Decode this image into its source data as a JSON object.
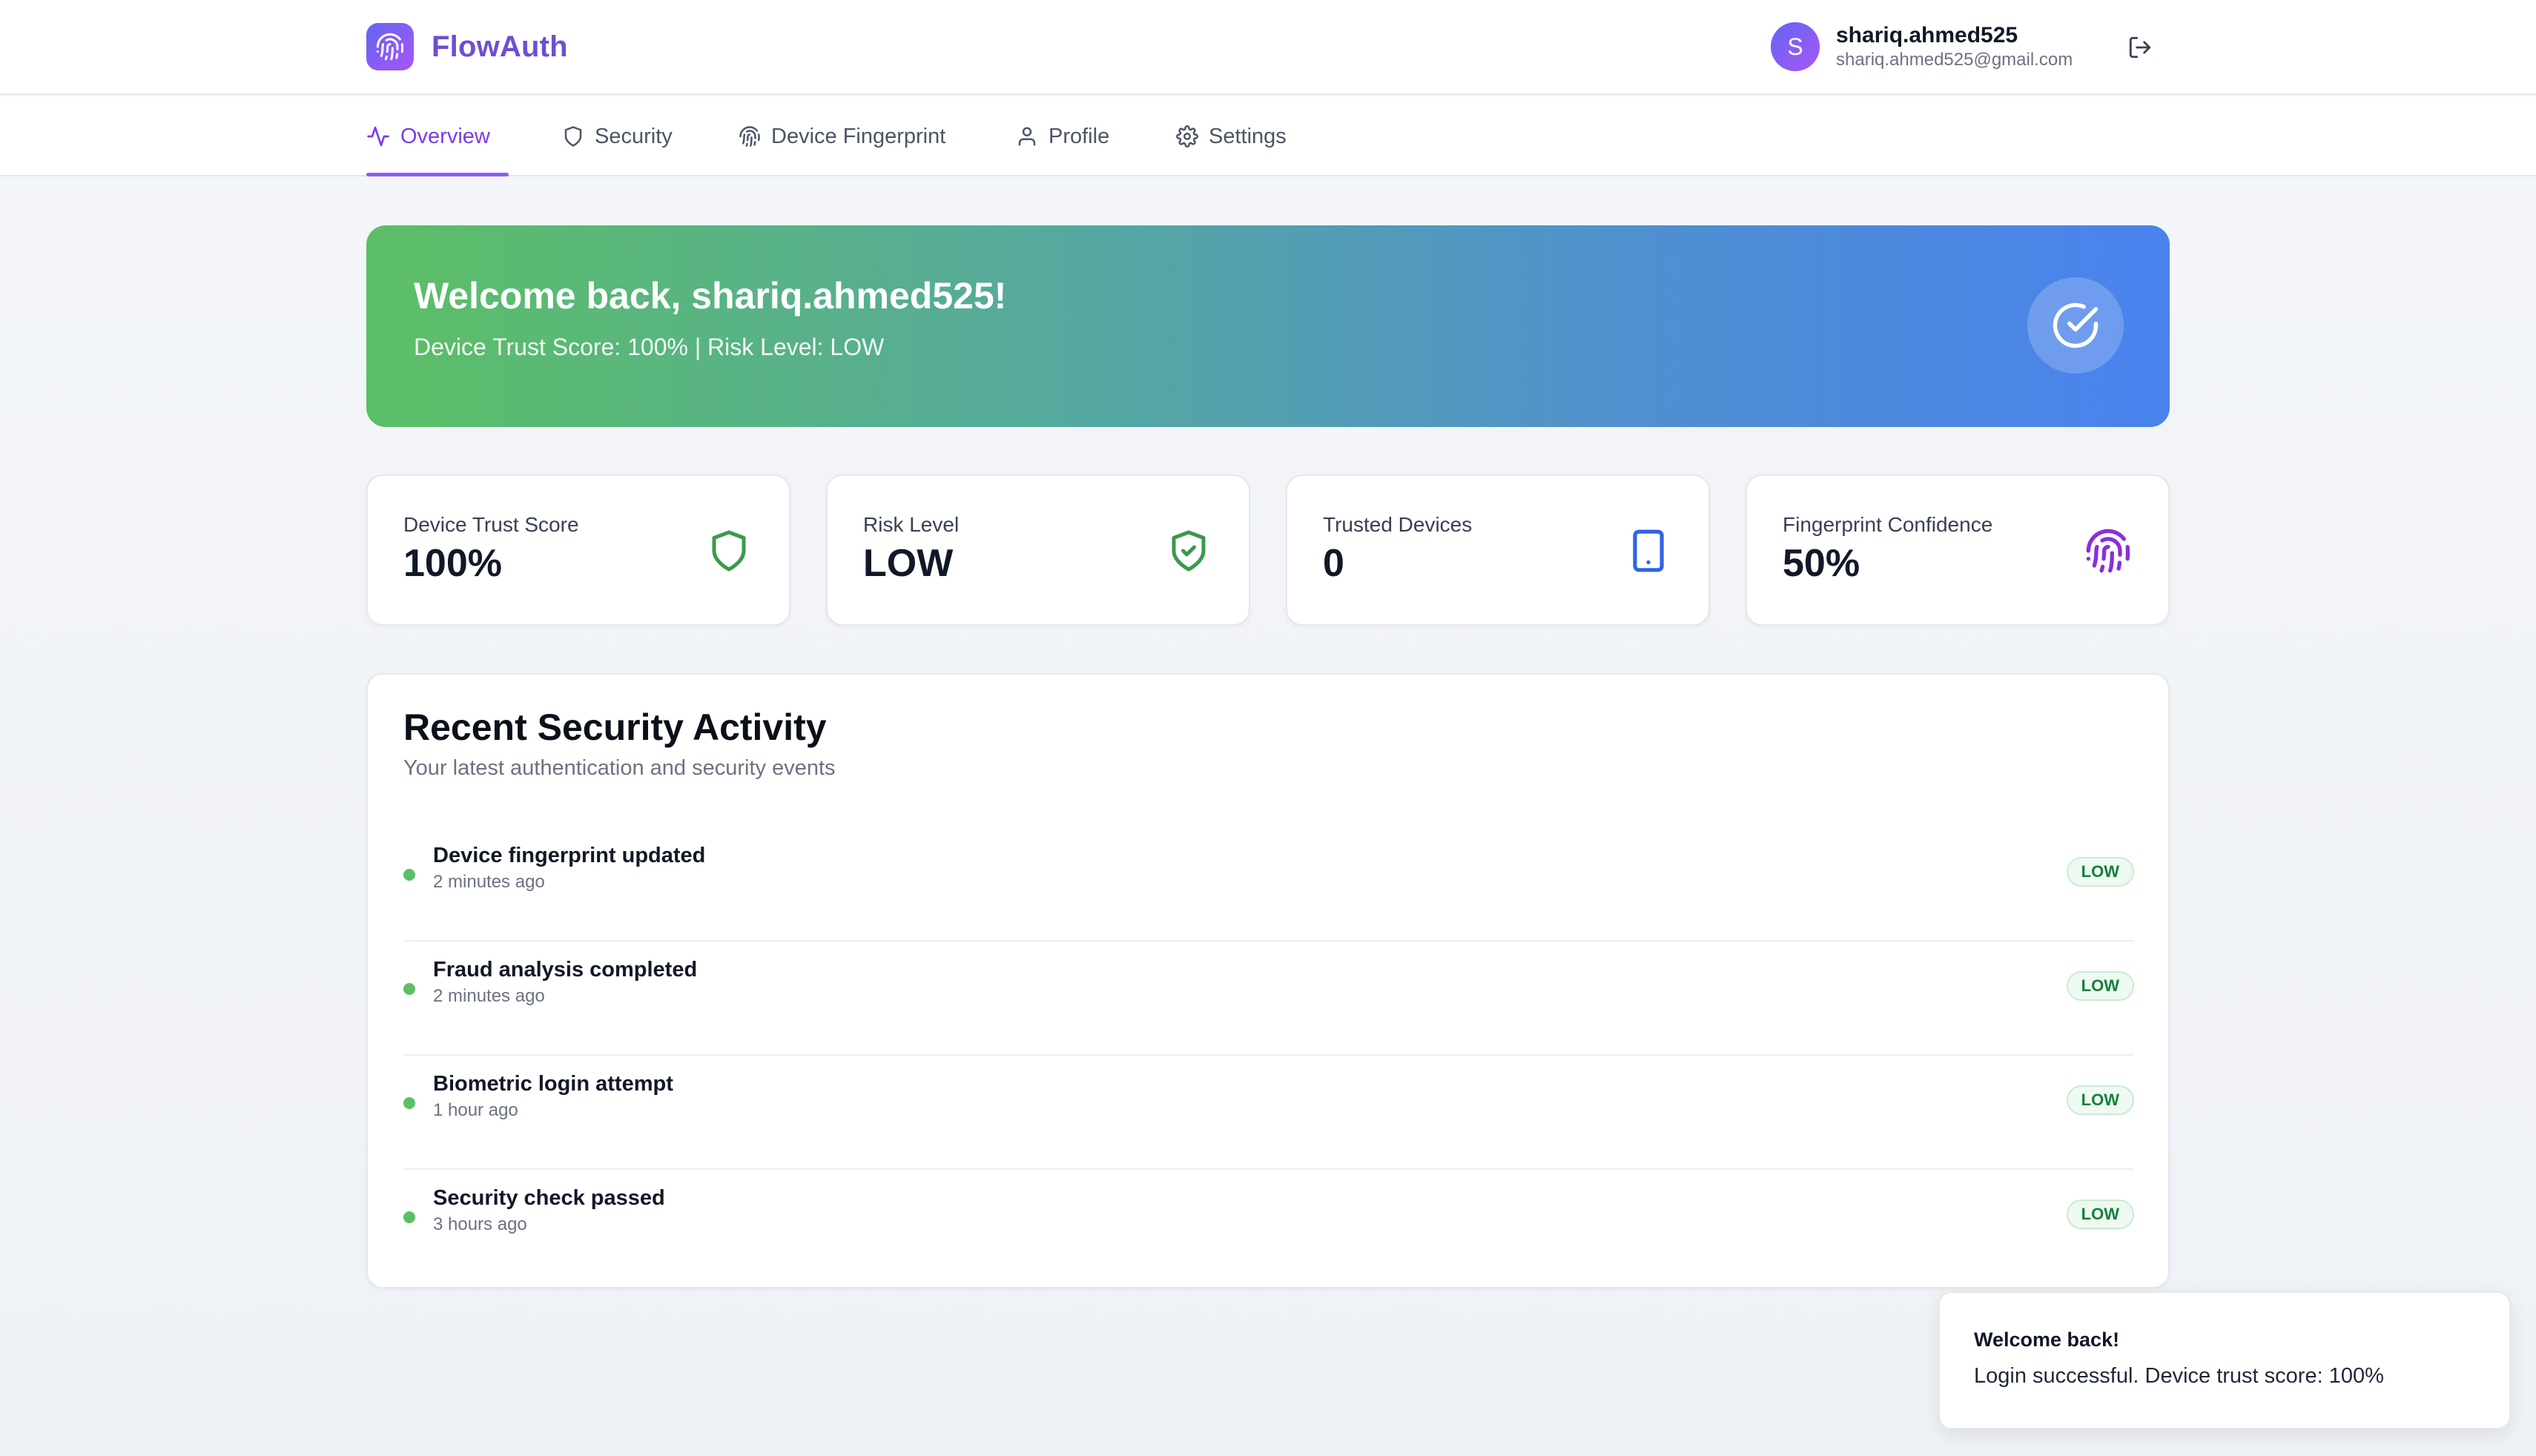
{
  "app": {
    "name": "FlowAuth",
    "logo_icon": "fingerprint-icon",
    "accent": "#7c3aed"
  },
  "user": {
    "initial": "S",
    "name": "shariq.ahmed525",
    "email": "shariq.ahmed525@gmail.com",
    "logout_icon": "logout-icon"
  },
  "nav": {
    "tabs": [
      {
        "label": "Overview",
        "icon": "activity-icon",
        "active": true
      },
      {
        "label": "Security",
        "icon": "shield-icon",
        "active": false
      },
      {
        "label": "Device Fingerprint",
        "icon": "fingerprint-icon",
        "active": false
      },
      {
        "label": "Profile",
        "icon": "user-icon",
        "active": false
      },
      {
        "label": "Settings",
        "icon": "gear-icon",
        "active": false
      }
    ]
  },
  "hero": {
    "title": "Welcome back, shariq.ahmed525!",
    "subtitle": "Device Trust Score: 100% | Risk Level: LOW",
    "icon": "check-circle-icon"
  },
  "stats": [
    {
      "label": "Device Trust Score",
      "value": "100%",
      "icon": "shield-icon",
      "color": "#3a9a4a"
    },
    {
      "label": "Risk Level",
      "value": "LOW",
      "icon": "shield-check-icon",
      "color": "#3a9a4a"
    },
    {
      "label": "Trusted Devices",
      "value": "0",
      "icon": "smartphone-icon",
      "color": "#2f63e6"
    },
    {
      "label": "Fingerprint Confidence",
      "value": "50%",
      "icon": "fingerprint-icon",
      "color": "#8b2fd9"
    }
  ],
  "activity": {
    "title": "Recent Security Activity",
    "subtitle": "Your latest authentication and security events",
    "items": [
      {
        "title": "Device fingerprint updated",
        "time": "2 minutes ago",
        "risk": "LOW"
      },
      {
        "title": "Fraud analysis completed",
        "time": "2 minutes ago",
        "risk": "LOW"
      },
      {
        "title": "Biometric login attempt",
        "time": "1 hour ago",
        "risk": "LOW"
      },
      {
        "title": "Security check passed",
        "time": "3 hours ago",
        "risk": "LOW"
      }
    ]
  },
  "toast": {
    "title": "Welcome back!",
    "message": "Login successful. Device trust score: 100%"
  }
}
